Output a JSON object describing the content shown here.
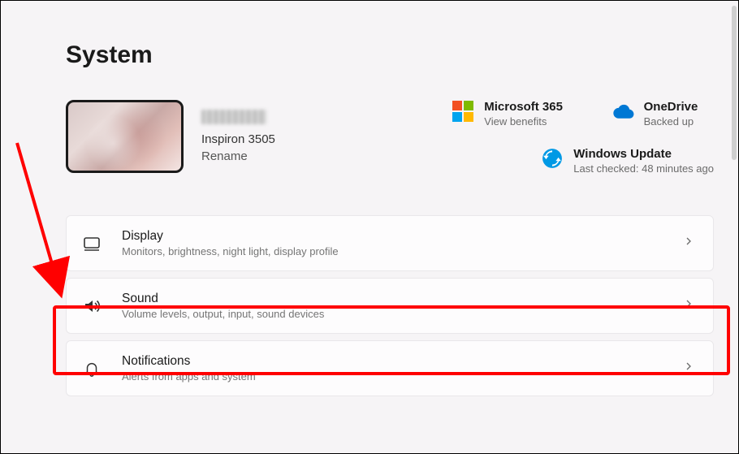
{
  "page": {
    "title": "System"
  },
  "device": {
    "model": "Inspiron 3505",
    "rename_label": "Rename"
  },
  "tiles": {
    "ms365": {
      "title": "Microsoft 365",
      "sub": "View benefits"
    },
    "onedrive": {
      "title": "OneDrive",
      "sub": "Backed up"
    },
    "winupdate": {
      "title": "Windows Update",
      "sub": "Last checked: 48 minutes ago"
    }
  },
  "cards": {
    "display": {
      "title": "Display",
      "sub": "Monitors, brightness, night light, display profile"
    },
    "sound": {
      "title": "Sound",
      "sub": "Volume levels, output, input, sound devices"
    },
    "notifications": {
      "title": "Notifications",
      "sub": "Alerts from apps and system"
    }
  }
}
